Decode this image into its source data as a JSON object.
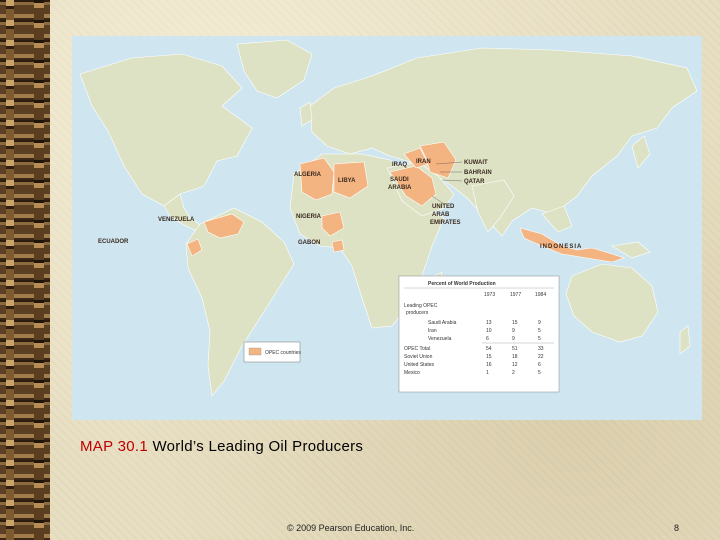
{
  "caption": {
    "map_number": "MAP 30.1",
    "title": "World’s Leading Oil Producers"
  },
  "footer": {
    "copyright": "© 2009 Pearson Education, Inc.",
    "page_number": "8"
  },
  "map": {
    "colors": {
      "ocean": "#cfe6f1",
      "land": "#dde2c4",
      "opec": "#f3b481",
      "border": "#ffffff"
    },
    "country_labels": {
      "algeria": "ALGERIA",
      "libya": "LIBYA",
      "iraq": "IRAQ",
      "iran": "IRAN",
      "kuwait": "KUWAIT",
      "bahrain": "BAHRAIN",
      "qatar": "QATAR",
      "saudi_1": "SAUDI",
      "saudi_2": "ARABIA",
      "uae_1": "UNITED",
      "uae_2": "ARAB",
      "uae_3": "EMIRATES",
      "venezuela": "VENEZUELA",
      "nigeria": "NIGERIA",
      "ecuador": "ECUADOR",
      "gabon": "GABON",
      "indonesia": "INDONESIA"
    },
    "legend": {
      "label": "OPEC countries"
    },
    "table": {
      "title": "Percent of World Production",
      "years": [
        "1973",
        "1977",
        "1984"
      ],
      "group_label_1": "Leading OPEC",
      "group_label_2": "producers",
      "rows": [
        {
          "label": "Saudi Arabia",
          "v1": "13",
          "v2": "15",
          "v3": "9"
        },
        {
          "label": "Iran",
          "v1": "10",
          "v2": "9",
          "v3": "5"
        },
        {
          "label": "Venezuela",
          "v1": "6",
          "v2": "9",
          "v3": "5"
        },
        {
          "label": "OPEC Total",
          "v1": "54",
          "v2": "51",
          "v3": "33"
        },
        {
          "label": "Soviet Union",
          "v1": "15",
          "v2": "18",
          "v3": "22"
        },
        {
          "label": "United States",
          "v1": "16",
          "v2": "12",
          "v3": "6"
        },
        {
          "label": "Mexico",
          "v1": "1",
          "v2": "2",
          "v3": "5"
        }
      ]
    }
  }
}
